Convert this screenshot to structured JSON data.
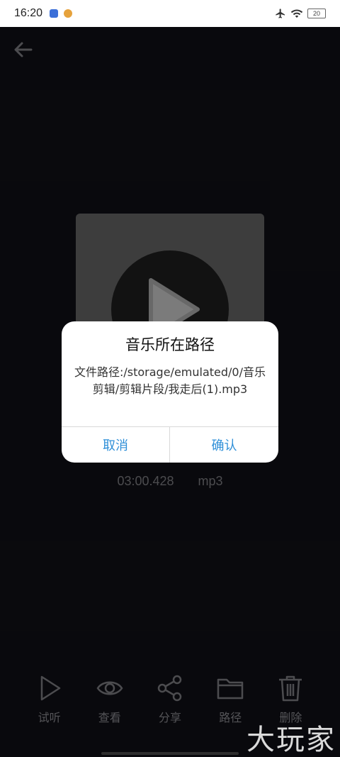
{
  "status_bar": {
    "time": "16:20",
    "battery": "20",
    "icons": [
      "baidu-icon",
      "weibo-icon",
      "airplane-icon",
      "wifi-icon",
      "battery-icon"
    ]
  },
  "nav": {
    "back_icon": "arrow-left-icon"
  },
  "player": {
    "duration": "03:00.428",
    "format": "mp3"
  },
  "dialog": {
    "title": "音乐所在路径",
    "message": "文件路径:/storage/emulated/0/音乐剪辑/剪辑片段/我走后(1).mp3",
    "cancel_label": "取消",
    "confirm_label": "确认"
  },
  "toolbar": {
    "items": [
      {
        "label": "试听",
        "icon": "play-icon"
      },
      {
        "label": "查看",
        "icon": "eye-icon"
      },
      {
        "label": "分享",
        "icon": "share-icon"
      },
      {
        "label": "路径",
        "icon": "folder-icon"
      },
      {
        "label": "删除",
        "icon": "trash-icon"
      }
    ]
  },
  "watermark": "大玩家",
  "colors": {
    "background": "#121218",
    "dialog_button": "#2f8fd8",
    "toolbar_icon": "#8a8a90"
  }
}
